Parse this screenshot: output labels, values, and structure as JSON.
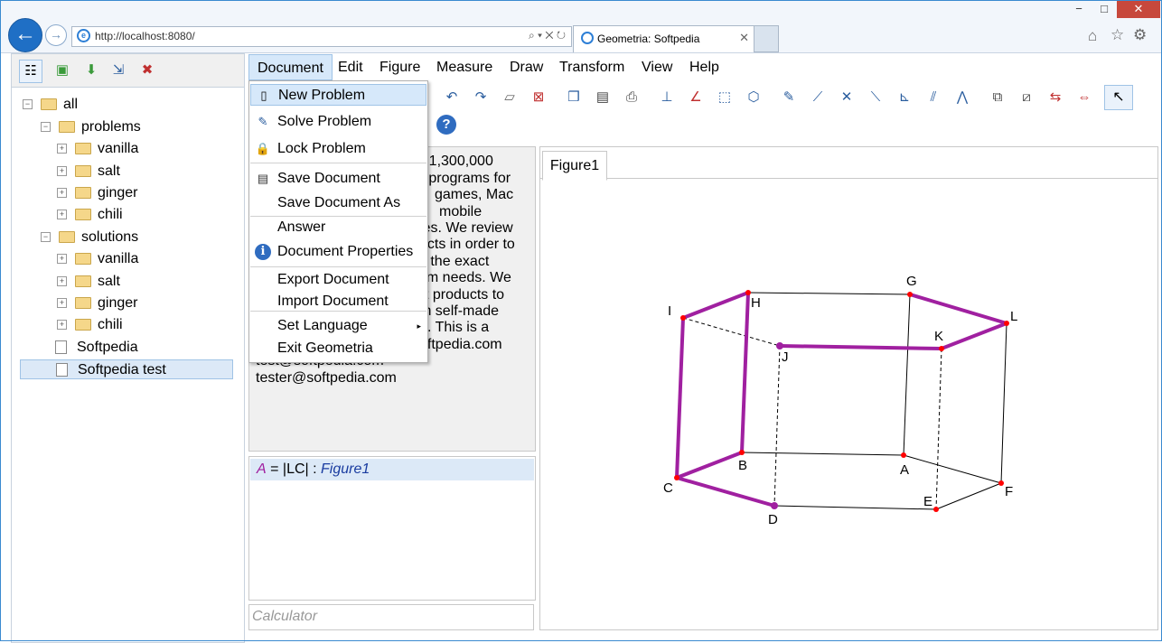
{
  "browser": {
    "url": "http://localhost:8080/",
    "tab_title": "Geometria: Softpedia",
    "window_controls": {
      "minimize": "−",
      "restore": "□",
      "close": "✕"
    }
  },
  "left_toolbar": {
    "icons": [
      "tree-view-icon",
      "new-folder-icon",
      "download-icon",
      "export-icon",
      "delete-icon"
    ]
  },
  "tree": [
    {
      "label": "all",
      "expander": "−"
    },
    {
      "label": "problems",
      "expander": "−"
    },
    {
      "label": "vanilla",
      "expander": "+"
    },
    {
      "label": "salt",
      "expander": "+"
    },
    {
      "label": "ginger",
      "expander": "+"
    },
    {
      "label": "chili",
      "expander": "+"
    },
    {
      "label": "solutions",
      "expander": "−"
    },
    {
      "label": "vanilla",
      "expander": "+"
    },
    {
      "label": "salt",
      "expander": "+"
    },
    {
      "label": "ginger",
      "expander": "+"
    },
    {
      "label": "chili",
      "expander": "+"
    },
    {
      "label": "Softpedia",
      "expander": ""
    },
    {
      "label": "Softpedia test",
      "expander": ""
    }
  ],
  "menubar": [
    "Document",
    "Edit",
    "Figure",
    "Measure",
    "Draw",
    "Transform",
    "View",
    "Help"
  ],
  "document_menu": [
    "New Problem",
    "Solve Problem",
    "Lock Problem",
    "Save Document",
    "Save Document As",
    "Answer",
    "Document Properties",
    "Export Document",
    "Import Document",
    "Set Language",
    "Exit Geometria"
  ],
  "text_panel": {
    "lines": [
      "er 1,300,000",
      "e programs for",
      "games, Mac",
      "mobile",
      "cles. We review",
      "ucts in order to",
      "d the exact",
      "em needs. We",
      "st products to",
      "th self-made",
      "s. This is a",
      "oftpedia.com",
      "test@softpedia.com",
      "tester@softpedia.com"
    ]
  },
  "formula": {
    "var": "A",
    "expr": " = |LC| : ",
    "ref": "Figure1"
  },
  "calculator": {
    "placeholder": "Calculator"
  },
  "figure": {
    "tab": "Figure1",
    "point_labels": [
      "A",
      "B",
      "C",
      "D",
      "E",
      "F",
      "G",
      "H",
      "I",
      "J",
      "K",
      "L"
    ]
  },
  "colors": {
    "accent": "#1f6fc5",
    "highlight": "#d6e8fa",
    "path": "#a020a0",
    "point": "#ff0000"
  }
}
